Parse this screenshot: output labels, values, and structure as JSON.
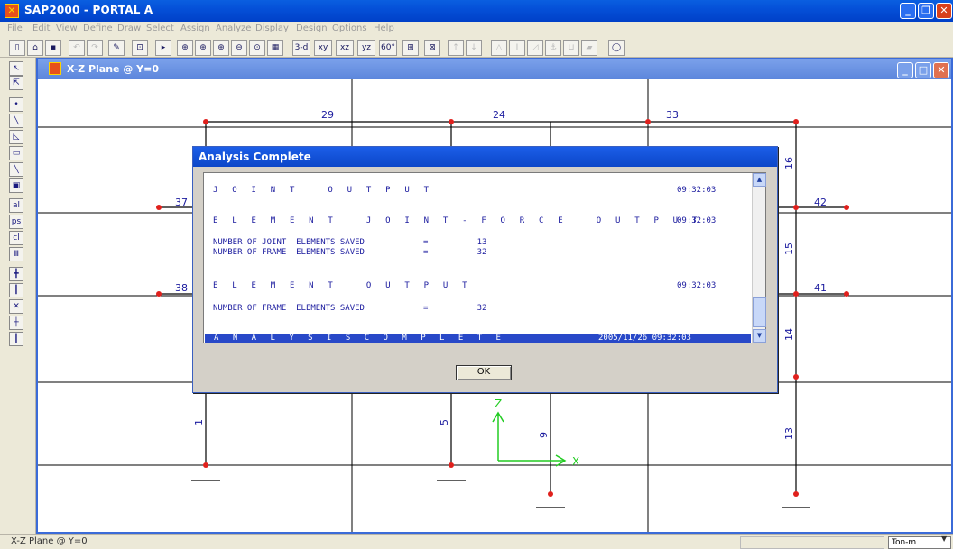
{
  "window": {
    "title": "SAP2000 - PORTAL A"
  },
  "menu": [
    "File",
    "Edit",
    "View",
    "Define",
    "Draw",
    "Select",
    "Assign",
    "Analyze",
    "Display",
    "Design",
    "Options",
    "Help"
  ],
  "toolbar": {
    "view_3d": "3-d",
    "view_xy": "xy",
    "view_xz": "xz",
    "view_yz": "yz",
    "view_rot": "60°"
  },
  "child_window": {
    "title": "X-Z Plane @ Y=0"
  },
  "drawing": {
    "frame_labels": [
      "29",
      "24",
      "33",
      "37",
      "42",
      "38",
      "41",
      "16",
      "15",
      "14",
      "13",
      "5",
      "9",
      "1"
    ],
    "axis_labels": {
      "z": "Z",
      "x": "X"
    }
  },
  "dialog": {
    "title": "Analysis Complete",
    "log": [
      {
        "text": "J O I N T   O U T P U T",
        "time": "09:32:03"
      },
      {
        "text": "E L E M E N T   J O I N T - F O R C E   O U T P U T",
        "time": "09:32:03"
      },
      {
        "text": "NUMBER OF JOINT  ELEMENTS SAVED            =          13"
      },
      {
        "text": "NUMBER OF FRAME  ELEMENTS SAVED            =          32"
      },
      {
        "text": "E L E M E N T   O U T P U T",
        "time": "09:32:03"
      },
      {
        "text": "NUMBER OF FRAME  ELEMENTS SAVED            =          32"
      }
    ],
    "complete": {
      "text": "A N A L Y S I S   C O M P L E T E",
      "date": "2005/11/26",
      "time": "09:32:03"
    },
    "ok_label": "OK"
  },
  "status": {
    "text": "X-Z Plane @ Y=0",
    "units": "Ton-m"
  },
  "colors": {
    "titlebar": "#0550d8",
    "log_text": "#1a1a9e",
    "joint": "#e0201c",
    "axis": "#22cc22"
  }
}
